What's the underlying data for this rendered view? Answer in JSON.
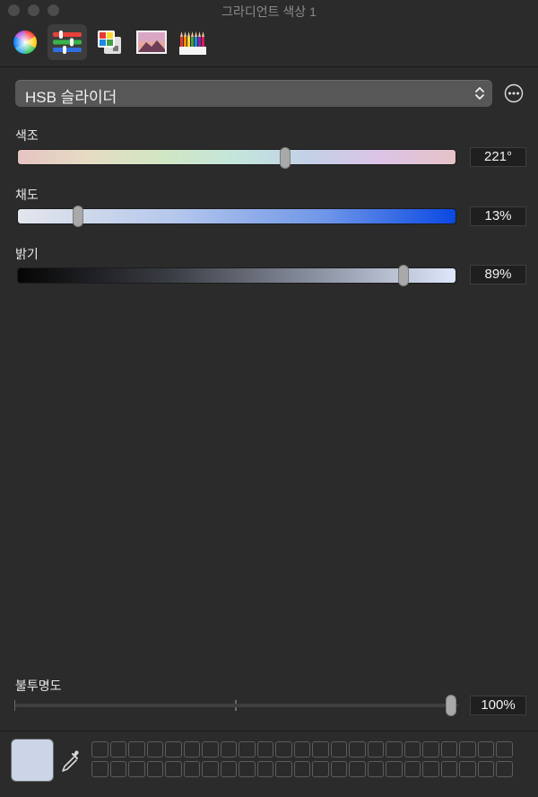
{
  "window": {
    "title": "그라디언트 색상 1"
  },
  "toolbar": {
    "tabs": [
      {
        "name": "color-wheel",
        "icon": "color-wheel-icon",
        "selected": false
      },
      {
        "name": "color-sliders",
        "icon": "sliders-icon",
        "selected": true
      },
      {
        "name": "color-palettes",
        "icon": "palette-icon",
        "selected": false
      },
      {
        "name": "image-palettes",
        "icon": "image-icon",
        "selected": false
      },
      {
        "name": "pencils",
        "icon": "pencils-icon",
        "selected": false
      }
    ]
  },
  "mode_select": {
    "value": "HSB 슬라이더",
    "icon": "chevron-up-down-icon"
  },
  "more_button": {
    "icon": "ellipsis-circle-icon"
  },
  "sliders": {
    "hue": {
      "label": "색조",
      "value": "221°",
      "position": 0.614
    },
    "saturation": {
      "label": "채도",
      "value": "13%",
      "position": 0.13
    },
    "brightness": {
      "label": "밝기",
      "value": "89%",
      "position": 0.89
    }
  },
  "opacity": {
    "label": "불투명도",
    "value": "100%",
    "position": 1.0
  },
  "current_color": "#ccd5e8",
  "swatch_wells": {
    "columns": 23,
    "rows": 2
  }
}
